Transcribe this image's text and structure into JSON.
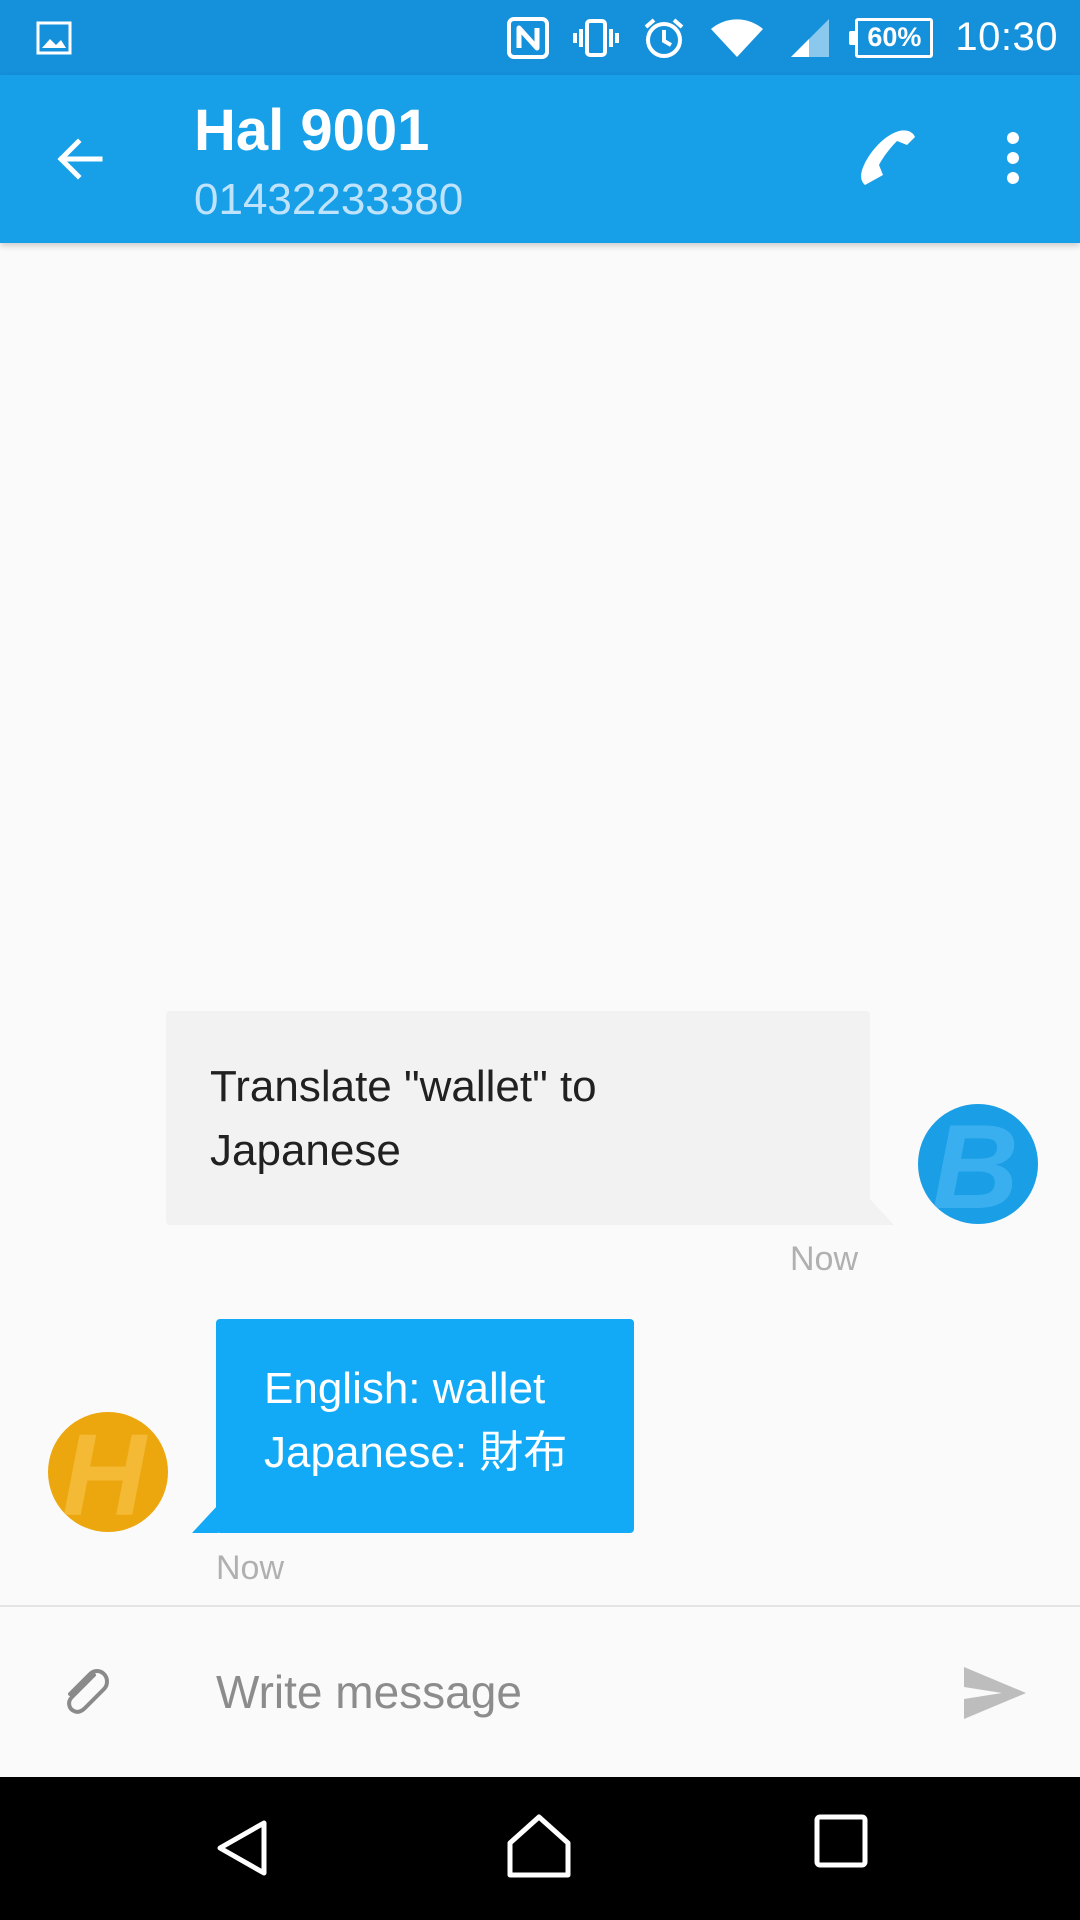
{
  "status_bar": {
    "icons": [
      "gallery-icon",
      "nfc-icon",
      "vibrate-icon",
      "alarm-icon",
      "wifi-icon",
      "cell-signal-icon",
      "battery-icon"
    ],
    "battery_percent": "60%",
    "time": "10:30"
  },
  "app_bar": {
    "back_icon": "arrow-left-icon",
    "contact_name": "Hal 9001",
    "contact_number": "01432233380",
    "call_icon": "phone-icon",
    "overflow_icon": "more-vertical-icon",
    "color": "#179fe8"
  },
  "messages": [
    {
      "direction": "outgoing",
      "lines": [
        "Translate \"wallet\" to",
        "Japanese"
      ],
      "time": "Now",
      "avatar_letter": "B",
      "bubble_color": "#f2f2f2",
      "avatar_color": "#1a9ee6"
    },
    {
      "direction": "incoming",
      "lines": [
        "English: wallet",
        "Japanese: 財布"
      ],
      "time": "Now",
      "avatar_letter": "H",
      "bubble_color": "#12aaf6",
      "avatar_color": "#eca70f"
    }
  ],
  "composer": {
    "attach_icon": "paperclip-icon",
    "placeholder": "Write message",
    "value": "",
    "send_icon": "send-icon"
  },
  "nav_bar": {
    "icons": [
      "back-triangle-icon",
      "home-icon",
      "recents-icon"
    ]
  }
}
